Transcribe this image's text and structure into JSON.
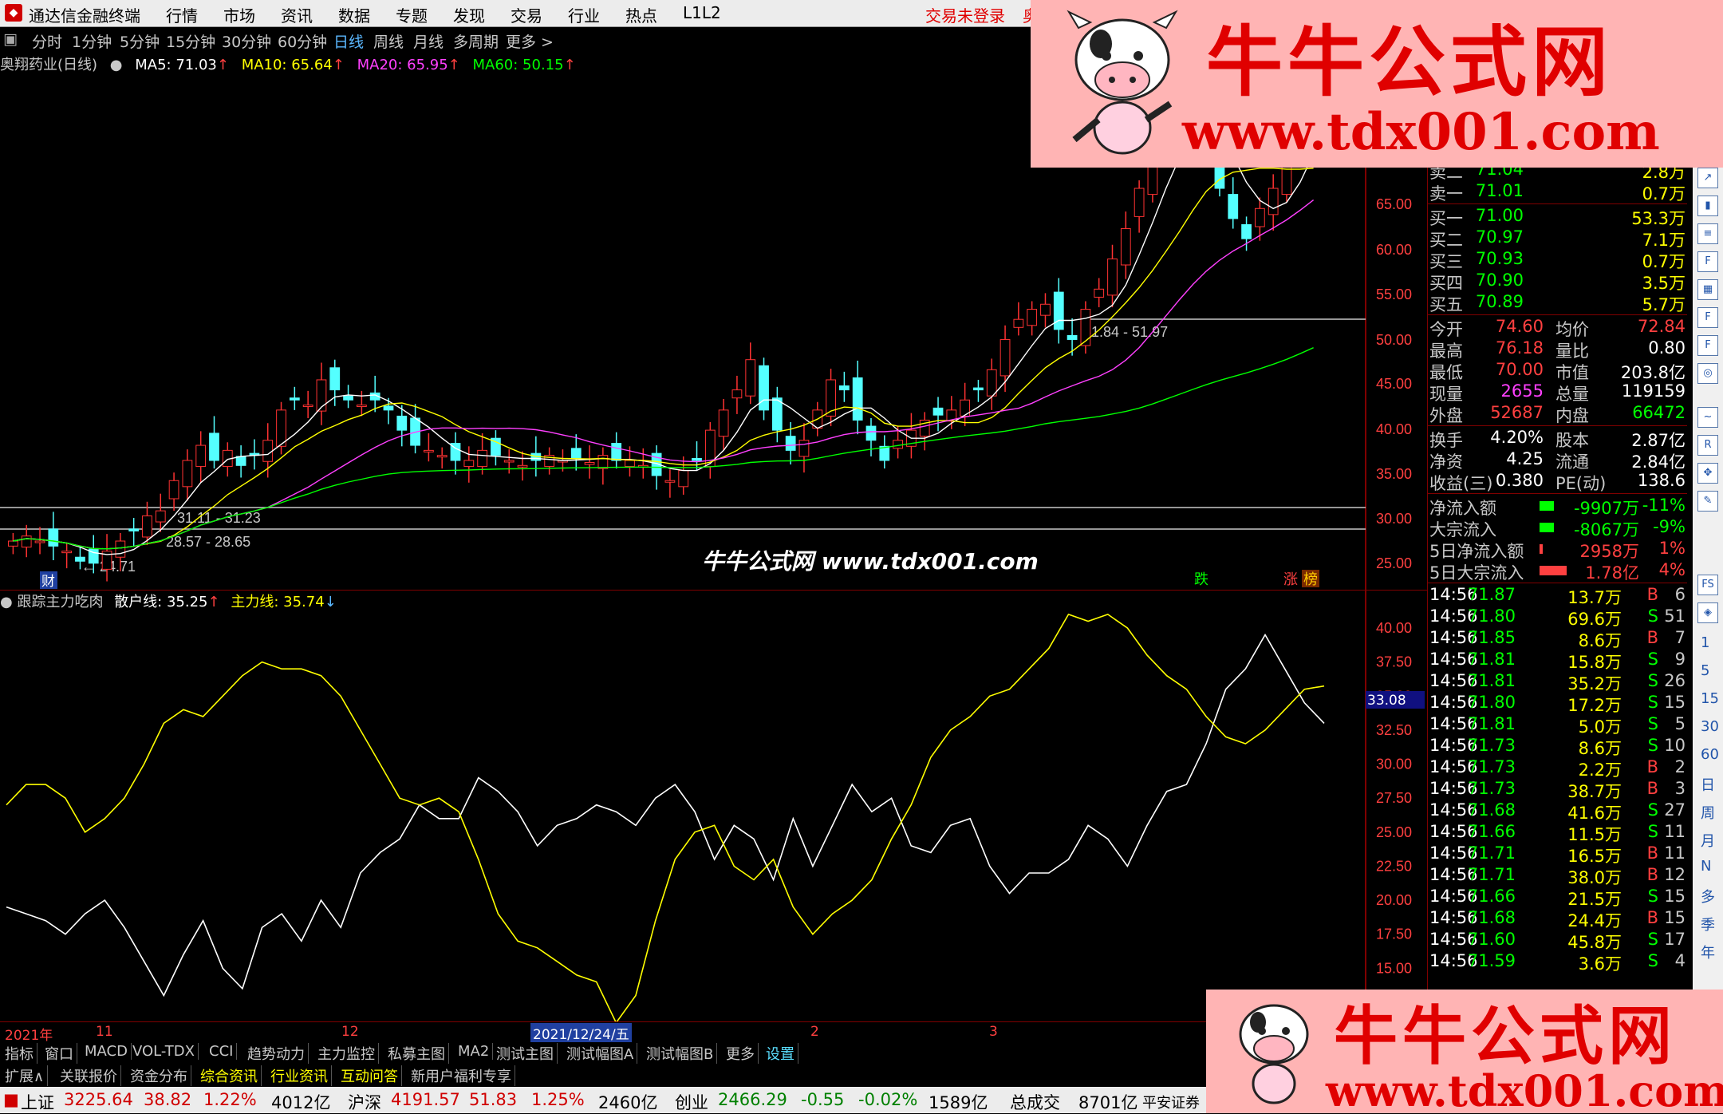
{
  "menubar": {
    "app_name": "通达信金融终端",
    "items": [
      "行情",
      "市场",
      "资讯",
      "数据",
      "专题",
      "发现",
      "交易",
      "行业",
      "热点",
      "L1L2"
    ],
    "trade_status": "交易未登录",
    "trade_extra": "奥"
  },
  "periods": {
    "items": [
      "分时",
      "1分钟",
      "5分钟",
      "15分钟",
      "30分钟",
      "60分钟",
      "日线",
      "周线",
      "月线",
      "多周期",
      "更多 >"
    ],
    "active": "日线"
  },
  "ma_legend": {
    "stock": "奥翔药业(日线)",
    "ma5": "MA5: 71.03",
    "ma10": "MA10: 65.64",
    "ma20": "MA20: 65.95",
    "ma60": "MA60: 50.15",
    "colors": {
      "ma5": "#ffffff",
      "ma10": "#ffff00",
      "ma20": "#ff40ff",
      "ma60": "#00ff00"
    }
  },
  "kchart": {
    "price_ticks": [
      "65.00",
      "60.00",
      "55.00",
      "50.00",
      "45.00",
      "40.00",
      "35.00",
      "30.00",
      "25.00"
    ],
    "annotations": {
      "range_high": "51.84 - 51.97",
      "range_mid": "31.11 - 31.23",
      "range_low": "28.57 - 28.65",
      "low_point": "← 24.71",
      "badge_cai": "财",
      "badge_die": "跌",
      "badge_zhang": "涨",
      "badge_bang": "榜"
    }
  },
  "subchart": {
    "title": "跟踪主力吃肉",
    "line1_label": "散户线: 35.25",
    "line2_label": "主力线: 35.74",
    "ticks": [
      "40.00",
      "37.50",
      "35.00",
      "32.50",
      "30.00",
      "27.50",
      "25.00",
      "22.50",
      "20.00",
      "17.50",
      "15.00",
      "12.50"
    ],
    "current_value": "33.08"
  },
  "chart_data": {
    "type": "line",
    "series": [
      {
        "name": "散户线",
        "values": [
          19.5,
          19.0,
          18.5,
          17.5,
          19.0,
          20.0,
          18.0,
          15.5,
          13.0,
          16.0,
          18.5,
          15.0,
          13.5,
          18.0,
          19.0,
          17.0,
          20.0,
          18.0,
          22.0,
          23.5,
          24.5,
          27.0,
          26.0,
          26.0,
          29.0,
          28.0,
          26.5,
          24.0,
          25.5,
          26.0,
          27.0,
          26.5,
          25.5,
          27.5,
          28.5,
          26.5,
          23.0,
          25.5,
          24.5,
          21.5,
          26.0,
          22.5,
          25.5,
          28.5,
          26.5,
          27.5,
          24.0,
          23.5,
          25.5,
          26.0,
          22.5,
          20.5,
          22.0,
          22.0,
          23.0,
          25.5,
          24.5,
          22.5,
          25.5,
          28.0,
          28.5,
          31.5,
          35.5,
          37.0,
          39.5,
          37.0,
          34.5,
          33.0
        ],
        "color": "#ffffff"
      },
      {
        "name": "主力线",
        "values": [
          27.0,
          28.5,
          28.5,
          27.5,
          25.0,
          26.0,
          27.5,
          30.0,
          33.0,
          34.0,
          33.5,
          35.0,
          36.5,
          37.5,
          37.0,
          37.0,
          36.5,
          35.0,
          32.5,
          30.0,
          27.5,
          27.0,
          27.5,
          26.5,
          23.0,
          19.0,
          17.0,
          16.5,
          15.5,
          14.5,
          14.0,
          11.0,
          13.0,
          18.5,
          23.0,
          25.0,
          25.5,
          22.5,
          21.5,
          23.0,
          19.5,
          17.5,
          19.0,
          20.0,
          21.5,
          24.5,
          27.0,
          30.5,
          32.5,
          33.5,
          35.0,
          35.5,
          37.0,
          38.5,
          41.0,
          40.5,
          41.0,
          40.0,
          38.0,
          36.5,
          35.5,
          33.5,
          32.0,
          31.5,
          32.5,
          34.0,
          35.5,
          35.74
        ],
        "color": "#ffff00"
      }
    ],
    "ylim": [
      12.5,
      40.0
    ],
    "title": "",
    "xlabel": "",
    "ylabel": "",
    "grid": false,
    "legend": "top-left"
  },
  "panel": {
    "sell_rows": [
      {
        "label": "卖二",
        "price": "71.04",
        "vol": "2.8万"
      },
      {
        "label": "卖一",
        "price": "71.01",
        "vol": "0.7万"
      }
    ],
    "buy_rows": [
      {
        "label": "买一",
        "price": "71.00",
        "vol": "53.3万"
      },
      {
        "label": "买二",
        "price": "70.97",
        "vol": "7.1万"
      },
      {
        "label": "买三",
        "price": "70.93",
        "vol": "0.7万"
      },
      {
        "label": "买四",
        "price": "70.90",
        "vol": "3.5万"
      },
      {
        "label": "买五",
        "price": "70.89",
        "vol": "5.7万"
      }
    ],
    "stats": [
      {
        "l1": "今开",
        "v1": "74.60",
        "l2": "均价",
        "v2": "72.84",
        "c1": "#ff4040",
        "c2": "#ff4040"
      },
      {
        "l1": "最高",
        "v1": "76.18",
        "l2": "量比",
        "v2": "0.80",
        "c1": "#ff4040",
        "c2": "#ffffff"
      },
      {
        "l1": "最低",
        "v1": "70.00",
        "l2": "市值",
        "v2": "203.8亿",
        "c1": "#ff4040",
        "c2": "#ffffff"
      },
      {
        "l1": "现量",
        "v1": "2655",
        "l2": "总量",
        "v2": "119159",
        "c1": "#ff40ff",
        "c2": "#ffffff"
      },
      {
        "l1": "外盘",
        "v1": "52687",
        "l2": "内盘",
        "v2": "66472",
        "c1": "#ff4040",
        "c2": "#00ff00"
      }
    ],
    "stats2": [
      {
        "l1": "换手",
        "v1": "4.20%",
        "l2": "股本",
        "v2": "2.87亿"
      },
      {
        "l1": "净资",
        "v1": "4.25",
        "l2": "流通",
        "v2": "2.84亿"
      },
      {
        "l1": "收益(三)",
        "v1": "0.380",
        "l2": "PE(动)",
        "v2": "138.6"
      }
    ],
    "flows": [
      {
        "label": "净流入额",
        "value": "-9907万",
        "pct": "-11%",
        "color": "#00ff00"
      },
      {
        "label": "大宗流入",
        "value": "-8067万",
        "pct": "-9%",
        "color": "#00ff00"
      },
      {
        "label": "5日净流入额",
        "value": "2958万",
        "pct": "1%",
        "color": "#ff4040"
      },
      {
        "label": "5日大宗流入",
        "value": "1.78亿",
        "pct": "4%",
        "color": "#ff4040"
      }
    ],
    "ticks": [
      {
        "t": "14:56",
        "p": "71.87",
        "v": "13.7万",
        "bs": "B",
        "n": "6"
      },
      {
        "t": "14:56",
        "p": "71.80",
        "v": "69.6万",
        "bs": "S",
        "n": "51"
      },
      {
        "t": "14:56",
        "p": "71.85",
        "v": "8.6万",
        "bs": "B",
        "n": "7"
      },
      {
        "t": "14:56",
        "p": "71.81",
        "v": "15.8万",
        "bs": "S",
        "n": "9"
      },
      {
        "t": "14:56",
        "p": "71.81",
        "v": "35.2万",
        "bs": "S",
        "n": "26"
      },
      {
        "t": "14:56",
        "p": "71.80",
        "v": "17.2万",
        "bs": "S",
        "n": "15"
      },
      {
        "t": "14:56",
        "p": "71.81",
        "v": "5.0万",
        "bs": "S",
        "n": "5"
      },
      {
        "t": "14:56",
        "p": "71.73",
        "v": "8.6万",
        "bs": "S",
        "n": "10"
      },
      {
        "t": "14:56",
        "p": "71.73",
        "v": "2.2万",
        "bs": "B",
        "n": "2"
      },
      {
        "t": "14:56",
        "p": "71.73",
        "v": "38.7万",
        "bs": "B",
        "n": "3"
      },
      {
        "t": "14:56",
        "p": "71.68",
        "v": "41.6万",
        "bs": "S",
        "n": "27"
      },
      {
        "t": "14:56",
        "p": "71.66",
        "v": "11.5万",
        "bs": "S",
        "n": "11"
      },
      {
        "t": "14:56",
        "p": "71.71",
        "v": "16.5万",
        "bs": "B",
        "n": "11"
      },
      {
        "t": "14:56",
        "p": "71.71",
        "v": "38.0万",
        "bs": "B",
        "n": "12"
      },
      {
        "t": "14:56",
        "p": "71.66",
        "v": "21.5万",
        "bs": "S",
        "n": "15"
      },
      {
        "t": "14:56",
        "p": "71.68",
        "v": "24.4万",
        "bs": "B",
        "n": "15"
      },
      {
        "t": "14:56",
        "p": "71.60",
        "v": "45.8万",
        "bs": "S",
        "n": "17"
      },
      {
        "t": "14:56",
        "p": "71.59",
        "v": "3.6万",
        "bs": "S",
        "n": "4"
      }
    ]
  },
  "sidebar_right": {
    "labels": [
      "1",
      "5",
      "15",
      "30",
      "60",
      "日",
      "周",
      "月",
      "N",
      "多",
      "季",
      "年"
    ]
  },
  "dateaxis": {
    "labels": [
      "2021年",
      "11",
      "12",
      "2021/12/24/五",
      "2",
      "3"
    ]
  },
  "tabs_row1": [
    "指标",
    "窗口",
    "MACD",
    "VOL-TDX",
    "CCI",
    "趋势动力",
    "主力监控",
    "私募主图",
    "MA2",
    "测试主图",
    "测试幅图A",
    "测试幅图B",
    "更多",
    "设置"
  ],
  "tabs_row2": [
    "扩展∧",
    "关联报价",
    "资金分布",
    "综合资讯",
    "行业资讯",
    "互动问答",
    "新用户福利专享"
  ],
  "statusbar": {
    "sh_label": "上证",
    "sh_value": "3225.64",
    "sh_chg": "38.82",
    "sh_pct": "1.22%",
    "sh_amt": "4012亿",
    "hs_label": "沪深",
    "hs_value": "4191.57",
    "hs_chg": "51.83",
    "hs_pct": "1.25%",
    "hs_amt": "2460亿",
    "cy_label": "创业",
    "cy_value": "2466.29",
    "cy_chg": "-0.55",
    "cy_pct": "-0.02%",
    "cy_amt": "1589亿",
    "total_label": "总成交",
    "total_value": "8701亿",
    "broker": "平安证券"
  },
  "watermark": {
    "cn": "牛牛公式网",
    "url": "www.tdx001.com",
    "mid": "牛牛公式网 www.tdx001.com"
  }
}
